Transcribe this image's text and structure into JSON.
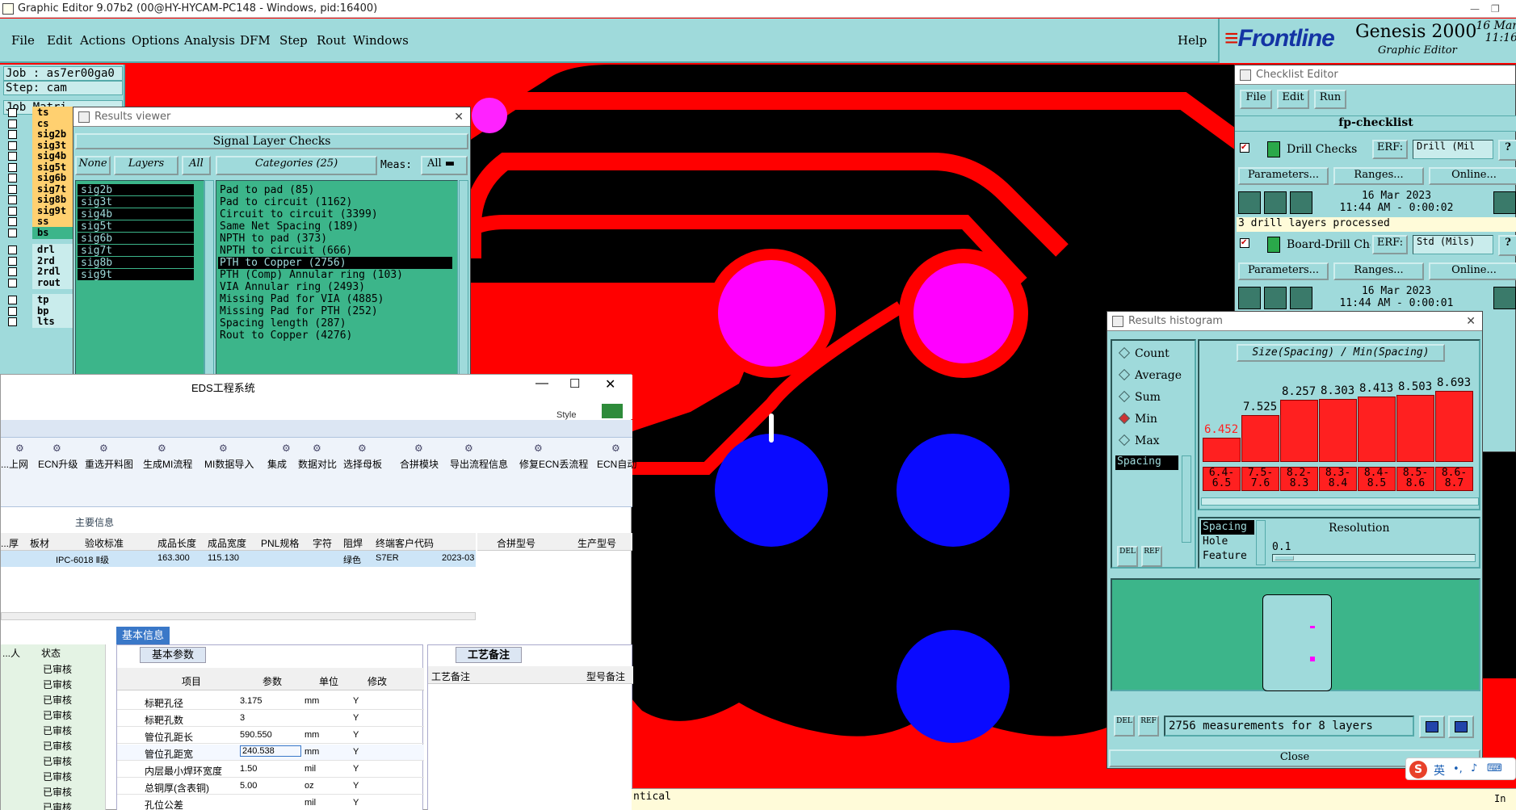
{
  "titlebar": {
    "title": "Graphic Editor 9.07b2 (00@HY-HYCAM-PC148 - Windows, pid:16400)"
  },
  "menu": [
    "File",
    "Edit",
    "Actions",
    "Options",
    "Analysis",
    "DFM",
    "Step",
    "Rout",
    "Windows"
  ],
  "help": "Help",
  "brand": {
    "logo": "Frontline",
    "product": "Genesis 2000",
    "subtitle": "Graphic Editor",
    "date": "16 Mar",
    "time": "11:16"
  },
  "job": {
    "job": "Job : as7er00ga0",
    "step": "Step: cam",
    "matrix": "Job Matri"
  },
  "layers": [
    {
      "name": "ts",
      "color": "#ffd070"
    },
    {
      "name": "cs",
      "color": "#ffd070"
    },
    {
      "name": "sig2b",
      "color": "#ffd070"
    },
    {
      "name": "sig3t",
      "color": "#ffd070"
    },
    {
      "name": "sig4b",
      "color": "#ffd070"
    },
    {
      "name": "sig5t",
      "color": "#ffd070"
    },
    {
      "name": "sig6b",
      "color": "#ffd070"
    },
    {
      "name": "sig7t",
      "color": "#ffd070"
    },
    {
      "name": "sig8b",
      "color": "#ffd070"
    },
    {
      "name": "sig9t",
      "color": "#ffd070"
    },
    {
      "name": "ss",
      "color": "#ffd070"
    },
    {
      "name": "bs",
      "color": "#3cb58a"
    },
    {
      "name": "drl",
      "color": "#c9ecec"
    },
    {
      "name": "2rd",
      "color": "#c9ecec"
    },
    {
      "name": "2rdl",
      "color": "#c9ecec"
    },
    {
      "name": "rout",
      "color": "#c9ecec"
    },
    {
      "name": "tp",
      "color": "#c9ecec"
    },
    {
      "name": "bp",
      "color": "#c9ecec"
    },
    {
      "name": "lts",
      "color": "#c9ecec"
    }
  ],
  "results_viewer": {
    "title": "Results viewer",
    "header": "Signal Layer Checks",
    "none": "None",
    "layers": "Layers",
    "all": "All",
    "categories": "Categories (25)",
    "meas_label": "Meas:",
    "meas_value": "All",
    "layer_list": [
      "sig2b",
      "sig3t",
      "sig4b",
      "sig5t",
      "sig6b",
      "sig7t",
      "sig8b",
      "sig9t"
    ],
    "category_list": [
      "Pad to pad (85)",
      "Pad to circuit (1162)",
      "Circuit to circuit (3399)",
      "Same Net Spacing (189)",
      "NPTH to pad (373)",
      "NPTH to circuit (666)",
      "PTH to Copper (2756)",
      "PTH (Comp) Annular ring (103)",
      "VIA Annular ring (2493)",
      "Missing Pad for VIA (4885)",
      "Missing Pad for PTH (252)",
      "Spacing length (287)",
      "Rout to Copper (4276)"
    ],
    "selected_index": 6
  },
  "checklist": {
    "title": "Checklist Editor",
    "menu": [
      "File",
      "Edit",
      "Run"
    ],
    "name": "fp-checklist",
    "items": [
      {
        "name": "Drill Checks",
        "erf_label": "ERF:",
        "erf": "Drill (Mil",
        "params": "Parameters...",
        "ranges": "Ranges...",
        "online": "Online...",
        "date": "16 Mar 2023",
        "time": "11:44 AM - 0:00:02",
        "status": "3 drill layers processed"
      },
      {
        "name": "Board-Drill Che",
        "erf_label": "ERF:",
        "erf": "Std (Mils)",
        "params": "Parameters...",
        "ranges": "Ranges...",
        "online": "Online...",
        "date": "16 Mar 2023",
        "time": "11:44 AM - 0:00:01"
      }
    ],
    "q": "?"
  },
  "histogram": {
    "title": "Results histogram",
    "header": "Size(Spacing) / Min(Spacing)",
    "options": [
      {
        "label": "Count",
        "on": false
      },
      {
        "label": "Average",
        "on": false
      },
      {
        "label": "Sum",
        "on": false
      },
      {
        "label": "Min",
        "on": true
      },
      {
        "label": "Max",
        "on": false
      }
    ],
    "selected_field": "Spacing",
    "chart_data": {
      "type": "bar",
      "categories": [
        "6.4-6.5",
        "7.5-7.6",
        "8.2-8.3",
        "8.3-8.4",
        "8.4-8.5",
        "8.5-8.6",
        "8.6-8.7"
      ],
      "values": [
        6.452,
        7.525,
        8.257,
        8.303,
        8.413,
        8.503,
        8.693
      ],
      "value_labels": [
        "6.452",
        "7.525",
        "8.257",
        "8.303",
        "8.413",
        "8.503",
        "8.693"
      ],
      "range_labels": [
        [
          "6.4-",
          "6.5"
        ],
        [
          "7.5-",
          "7.6"
        ],
        [
          "8.2-",
          "8.3"
        ],
        [
          "8.3-",
          "8.4"
        ],
        [
          "8.4-",
          "8.5"
        ],
        [
          "8.5-",
          "8.6"
        ],
        [
          "8.6-",
          "8.7"
        ]
      ],
      "title": "Size(Spacing) / Min(Spacing)",
      "ylim": [
        0,
        9
      ]
    },
    "fields": [
      "Spacing",
      "Hole",
      "Feature"
    ],
    "resolution_label": "Resolution",
    "resolution_value": "0.1",
    "summary": "2756 measurements for 8 layers",
    "del": "DEL",
    "ref": "REF",
    "close": "Close"
  },
  "eds": {
    "title": "EDS工程系统",
    "style": "Style",
    "toolbar": [
      "...上网",
      "ECN升级",
      "重选开料图",
      "生成MI流程",
      "MI数据导入",
      "集成",
      "数据对比",
      "选择母板",
      "合拼模块",
      "导出流程信息",
      "修复ECN丢流程",
      "ECN自动"
    ],
    "main_info": "主要信息",
    "columns": [
      "...厚",
      "板材",
      "验收标准",
      "成品长度",
      "成品宽度",
      "PNL规格",
      "字符",
      "阻焊",
      "终端客户代码"
    ],
    "row": [
      "",
      "",
      "IPC-6018 Ⅱ级",
      "163.300",
      "115.130",
      "",
      "",
      "绿色",
      "S7ER",
      "2023-03"
    ],
    "right_cols": [
      "合拼型号",
      "生产型号"
    ],
    "left_list_header": [
      "...人",
      "状态"
    ],
    "left_list": [
      "已审核",
      "已审核",
      "已审核",
      "已审核",
      "已审核",
      "已审核",
      "已审核",
      "已审核",
      "已审核",
      "已审核"
    ],
    "tab_basic": "基本信息",
    "tab_params": "基本参数",
    "param_cols": [
      "项目",
      "参数",
      "单位",
      "修改"
    ],
    "params": [
      [
        "标靶孔径",
        "3.175",
        "mm",
        "Y"
      ],
      [
        "标靶孔数",
        "3",
        "",
        "Y"
      ],
      [
        "管位孔距长",
        "590.550",
        "mm",
        "Y"
      ],
      [
        "管位孔距宽",
        "240.538",
        "mm",
        "Y"
      ],
      [
        "内层最小焊环宽度",
        "1.50",
        "mil",
        "Y"
      ],
      [
        "总铜厚(含表铜)",
        "5.00",
        "oz",
        "Y"
      ],
      [
        "孔位公差",
        "",
        "mil",
        "Y"
      ]
    ],
    "process_tab": "工艺备注",
    "process_col": "工艺备注",
    "model_col": "型号备注"
  },
  "status_text": "ntical",
  "ime": {
    "label": "英"
  },
  "corner": "In"
}
